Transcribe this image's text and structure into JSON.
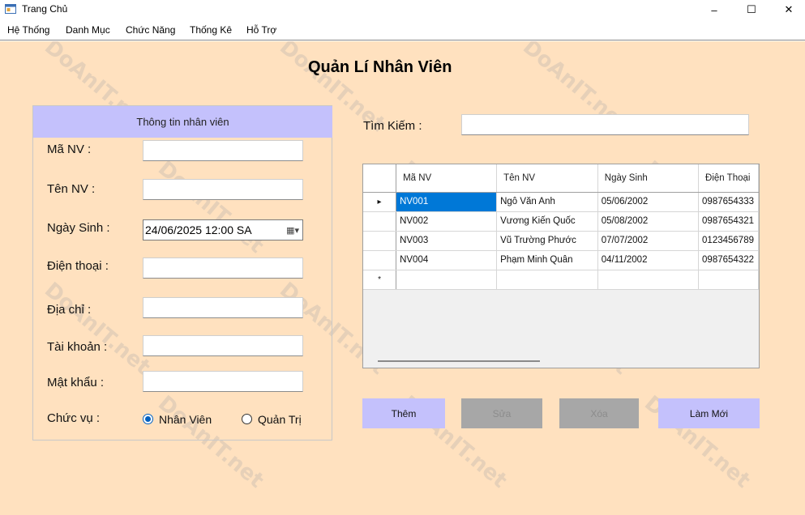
{
  "window": {
    "title": "Trang Chủ",
    "minimize_glyph": "–",
    "maximize_glyph": "☐",
    "close_glyph": "✕"
  },
  "menu": [
    "Hệ Thống",
    "Danh Mục",
    "Chức Năng",
    "Thống Kê",
    "Hỗ Trợ"
  ],
  "watermark": "DoAnIT.net",
  "page_title": "Quản Lí Nhân Viên",
  "form": {
    "header": "Thông tin nhân viên",
    "labels": {
      "ma_nv": "Mã NV :",
      "ten_nv": "Tên NV :",
      "ngay_sinh": "Ngày Sinh :",
      "dien_thoai": "Điện thoại :",
      "dia_chi": "Địa chỉ :",
      "tai_khoan": "Tài khoản :",
      "mat_khau": "Mật khẩu :",
      "chuc_vu": "Chức vụ :"
    },
    "date_value": "24/06/2025 12:00 SA",
    "radio": {
      "nhan_vien": "Nhân Viên",
      "quan_tri": "Quản Trị",
      "selected": "Nhân Viên"
    }
  },
  "search": {
    "label": "Tìm Kiếm :",
    "value": ""
  },
  "grid": {
    "columns": [
      "Mã NV",
      "Tên NV",
      "Ngày Sinh",
      "Điện Thoại"
    ],
    "rows": [
      [
        "NV001",
        "Ngô Văn Anh",
        "05/06/2002",
        "0987654333"
      ],
      [
        "NV002",
        "Vương Kiến Quốc",
        "05/08/2002",
        "0987654321"
      ],
      [
        "NV003",
        "Vũ Trường Phước",
        "07/07/2002",
        "0123456789"
      ],
      [
        "NV004",
        "Phạm Minh Quân",
        "04/11/2002",
        "0987654322"
      ]
    ],
    "current_row_marker": "▸",
    "new_row_marker": "*"
  },
  "buttons": {
    "them": "Thêm",
    "sua": "Sửa",
    "xoa": "Xóa",
    "lam_moi": "Làm Mới"
  },
  "colors": {
    "background": "#ffe1bf",
    "accent": "#c4c1fc",
    "disabled": "#a7a7a7",
    "selection": "#0078d7"
  }
}
